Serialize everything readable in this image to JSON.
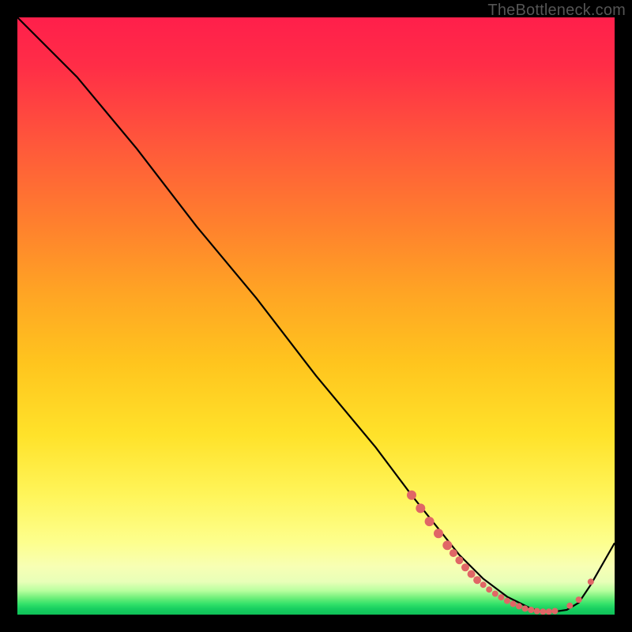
{
  "watermark": "TheBottleneck.com",
  "colors": {
    "curve": "#000000",
    "marker_fill": "#e06666",
    "marker_stroke": "#c94f4f"
  },
  "chart_data": {
    "type": "line",
    "title": "",
    "xlabel": "",
    "ylabel": "",
    "xlim": [
      0,
      100
    ],
    "ylim": [
      0,
      100
    ],
    "grid": false,
    "legend": false,
    "series": [
      {
        "name": "bottleneck-curve",
        "x": [
          0,
          6,
          10,
          20,
          30,
          40,
          50,
          60,
          66,
          70,
          74,
          78,
          82,
          86,
          88,
          90,
          92,
          94,
          96,
          100
        ],
        "y": [
          100,
          94,
          90,
          78,
          65,
          53,
          40,
          28,
          20,
          15,
          10,
          6,
          3,
          1,
          0.5,
          0.5,
          0.8,
          2,
          5,
          12
        ]
      }
    ],
    "markers": [
      {
        "x": 66.0,
        "y": 20.0,
        "r": 6
      },
      {
        "x": 67.5,
        "y": 17.8,
        "r": 6
      },
      {
        "x": 69.0,
        "y": 15.6,
        "r": 6
      },
      {
        "x": 70.5,
        "y": 13.6,
        "r": 6
      },
      {
        "x": 72.0,
        "y": 11.6,
        "r": 6
      },
      {
        "x": 73.0,
        "y": 10.3,
        "r": 5
      },
      {
        "x": 74.0,
        "y": 9.1,
        "r": 5
      },
      {
        "x": 75.0,
        "y": 7.9,
        "r": 5
      },
      {
        "x": 76.0,
        "y": 6.8,
        "r": 5
      },
      {
        "x": 77.0,
        "y": 5.8,
        "r": 5
      },
      {
        "x": 78.0,
        "y": 5.0,
        "r": 4
      },
      {
        "x": 79.0,
        "y": 4.2,
        "r": 4
      },
      {
        "x": 80.0,
        "y": 3.5,
        "r": 4
      },
      {
        "x": 81.0,
        "y": 2.9,
        "r": 4
      },
      {
        "x": 82.0,
        "y": 2.3,
        "r": 4
      },
      {
        "x": 83.0,
        "y": 1.8,
        "r": 4
      },
      {
        "x": 84.0,
        "y": 1.4,
        "r": 4
      },
      {
        "x": 85.0,
        "y": 1.0,
        "r": 4
      },
      {
        "x": 86.0,
        "y": 0.8,
        "r": 4
      },
      {
        "x": 87.0,
        "y": 0.6,
        "r": 4
      },
      {
        "x": 88.0,
        "y": 0.5,
        "r": 4
      },
      {
        "x": 89.0,
        "y": 0.5,
        "r": 4
      },
      {
        "x": 90.0,
        "y": 0.6,
        "r": 4
      },
      {
        "x": 92.5,
        "y": 1.5,
        "r": 4
      },
      {
        "x": 94.0,
        "y": 2.5,
        "r": 4
      },
      {
        "x": 96.0,
        "y": 5.5,
        "r": 4
      }
    ]
  }
}
